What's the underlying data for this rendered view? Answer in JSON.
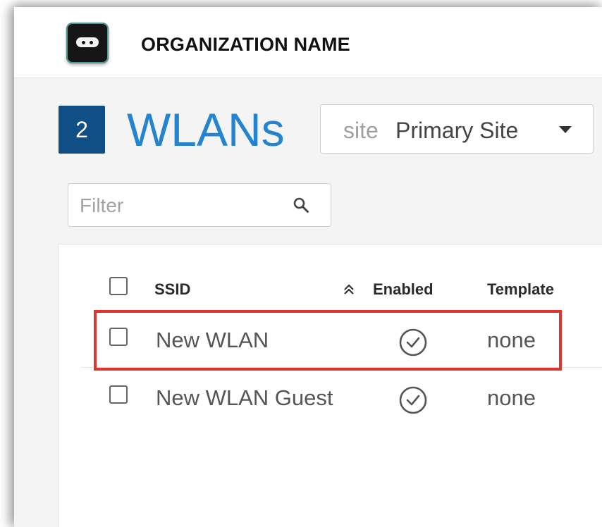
{
  "header": {
    "org_name": "ORGANIZATION NAME"
  },
  "page": {
    "count_badge": "2",
    "title": "WLANs"
  },
  "site_selector": {
    "label": "site",
    "value": "Primary Site"
  },
  "filter": {
    "placeholder": "Filter",
    "value": ""
  },
  "table": {
    "columns": [
      "SSID",
      "Enabled",
      "Template"
    ],
    "rows": [
      {
        "ssid": "New WLAN",
        "enabled": true,
        "template": "none"
      },
      {
        "ssid": "New WLAN Guest",
        "enabled": true,
        "template": "none"
      }
    ]
  },
  "colors": {
    "accent": "#2584cf",
    "badge": "#0f4f86",
    "highlight": "#e0352e"
  },
  "icons": [
    "app-logo-icon",
    "search-icon",
    "sort-double-chevron-up-icon",
    "check-circle-icon",
    "chevron-down-icon"
  ]
}
